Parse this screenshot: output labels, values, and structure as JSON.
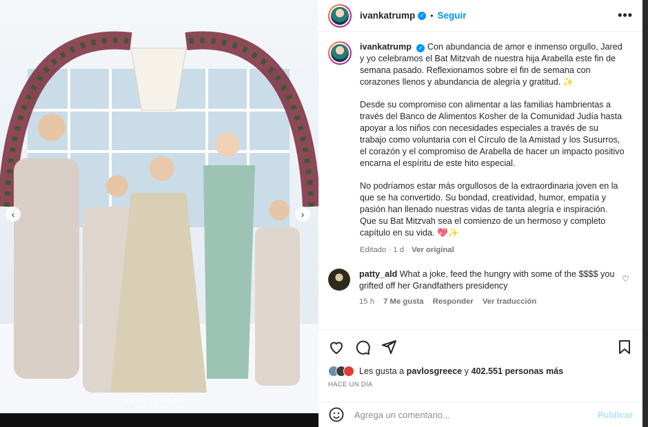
{
  "colors": {
    "accent": "#0095f6",
    "text": "#262626",
    "muted": "#737373"
  },
  "post": {
    "username": "ivankatrump",
    "follow_label": "Seguir",
    "separator": "•",
    "more_label": "•••",
    "slide_count": 10,
    "active_slide": 8,
    "prev_icon": "chevron-left-icon",
    "next_icon": "chevron-right-icon"
  },
  "caption": {
    "username": "ivankatrump",
    "p1": "Con abundancia de amor e inmenso orgullo, Jared y yo celebramos el Bat Mitzvah de nuestra hija Arabella este fin de semana pasado. Reflexionamos sobre el fin de semana con corazones llenos y abundancia de alegría y gratitud. ✨",
    "p2": "Desde su compromiso con alimentar a las familias hambrientas a través del Banco de Alimentos Kosher de la Comunidad Judía hasta apoyar a los niños con necesidades especiales a través de su trabajo como voluntaria con el Círculo de la Amistad y los Susurros, el corazón y el compromiso de Arabella de hacer un impacto positivo encarna el espíritu de este hito especial.",
    "p3": "No podríamos estar más orgullosos de la extraordinaria joven en la que se ha convertido. Su bondad, creatividad, humor, empatía y pasión han llenado nuestras vidas de tanta alegría e inspiración. Que su Bat Mitzvah sea el comienzo de un hermoso y completo capítulo en su vida. 💖✨",
    "edited": "Editado · 1 d",
    "see_original": "Ver original"
  },
  "comment": {
    "username": "patty_ald",
    "text": "What a joke, feed the hungry with some of the $$$$ you grifted off her Grandfathers presidency",
    "time": "15 h",
    "likes": "7 Me gusta",
    "reply": "Responder",
    "translate": "Ver traducción"
  },
  "likes": {
    "prefix": "Les gusta a",
    "user": "pavlosgreece",
    "middle": "y",
    "count": "402.551 personas más",
    "timestamp": "HACE UN DÍA"
  },
  "add_comment": {
    "placeholder": "Agrega un comentario...",
    "publish": "Publicar"
  }
}
